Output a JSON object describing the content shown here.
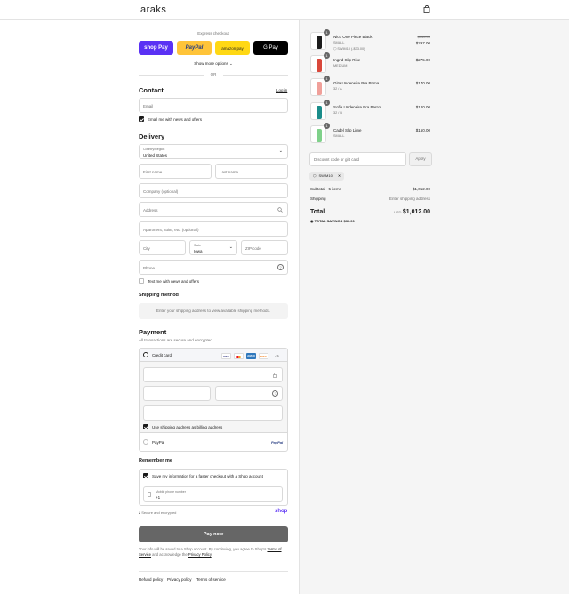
{
  "header": {
    "logo": "araks",
    "bag_icon": "bag-icon"
  },
  "express": {
    "title": "Express checkout",
    "buttons": [
      {
        "label": "shop Pay",
        "color": "#5a31f4"
      },
      {
        "label": "PayPal",
        "color": "#ffc439"
      },
      {
        "label": "amazon pay",
        "color": "#ffd814"
      },
      {
        "label": "G Pay",
        "color": "#000000"
      }
    ],
    "show_more": "Show more options",
    "or": "OR"
  },
  "contact": {
    "title": "Contact",
    "login": "Log in",
    "email_placeholder": "Email",
    "email_news": "Email me with news and offers"
  },
  "delivery": {
    "title": "Delivery",
    "country_label": "Country/Region",
    "country_value": "United States",
    "first_name": "First name",
    "last_name": "Last name",
    "company": "Company (optional)",
    "address": "Address",
    "apartment": "Apartment, suite, etc. (optional)",
    "city": "City",
    "state_label": "State",
    "state_value": "Iowa",
    "zip": "ZIP code",
    "phone": "Phone",
    "text_news": "Text me with news and offers"
  },
  "shipping": {
    "title": "Shipping method",
    "message": "Enter your shipping address to view available shipping methods."
  },
  "payment": {
    "title": "Payment",
    "subtitle": "All transactions are secure and encrypted.",
    "credit_card": "Credit card",
    "card_icons": [
      {
        "label": "VISA",
        "color": "#1a1f71"
      },
      {
        "label": "MC",
        "color": "#eb001b"
      },
      {
        "label": "AMEX",
        "color": "#2e77bc"
      },
      {
        "label": "DISC",
        "color": "#f58220"
      }
    ],
    "more_cards": "+3",
    "billing_same": "Use shipping address as billing address",
    "paypal": "PayPal",
    "paypal_logo": "PayPal"
  },
  "remember": {
    "title": "Remember me",
    "save_info": "Save my information for a faster checkout with a Shop account",
    "mobile_label": "Mobile phone number",
    "mobile_value": "+1"
  },
  "secure": {
    "text": "Secure and encrypted",
    "shop": "shop"
  },
  "pay_button": "Pay now",
  "legal": {
    "text": "Your info will be saved to a Shop account. By continuing, you agree to Shop's",
    "terms": "Terms of Service",
    "and": "and acknowledge the",
    "privacy": "Privacy Policy"
  },
  "footer": {
    "refund": "Refund policy",
    "privacy": "Privacy policy",
    "terms": "Terms of service"
  },
  "cart": {
    "items": [
      {
        "name": "Nico One Piece Black",
        "variant": "SMALL",
        "discount": "SWIM10 (-$33.00)",
        "old_price": "$330.00",
        "price": "$297.00",
        "qty": "1",
        "color": "#1c1c1c"
      },
      {
        "name": "Ingrid Slip Rise",
        "variant": "MEDIUM",
        "price": "$275.00",
        "qty": "1",
        "color": "#d9483b"
      },
      {
        "name": "Gita Underwire Bra Prima",
        "variant": "32 / A",
        "price": "$170.00",
        "qty": "1",
        "color": "#f0a09a"
      },
      {
        "name": "Sofia Underwire Bra Parrot",
        "variant": "32 / B",
        "price": "$120.00",
        "qty": "1",
        "color": "#1a8c8a"
      },
      {
        "name": "Cadel Slip Lime",
        "variant": "SMALL",
        "price": "$150.00",
        "qty": "1",
        "color": "#7fd18a"
      }
    ],
    "discount_placeholder": "Discount code or gift card",
    "apply": "Apply",
    "code_tag": "SWIM10",
    "subtotal_label": "Subtotal · 5 items",
    "subtotal": "$1,012.00",
    "shipping_label": "Shipping",
    "shipping_value": "Enter shipping address",
    "total_label": "Total",
    "currency": "USD",
    "total": "$1,012.00",
    "savings_label": "TOTAL SAVINGS",
    "savings": "$33.00"
  }
}
